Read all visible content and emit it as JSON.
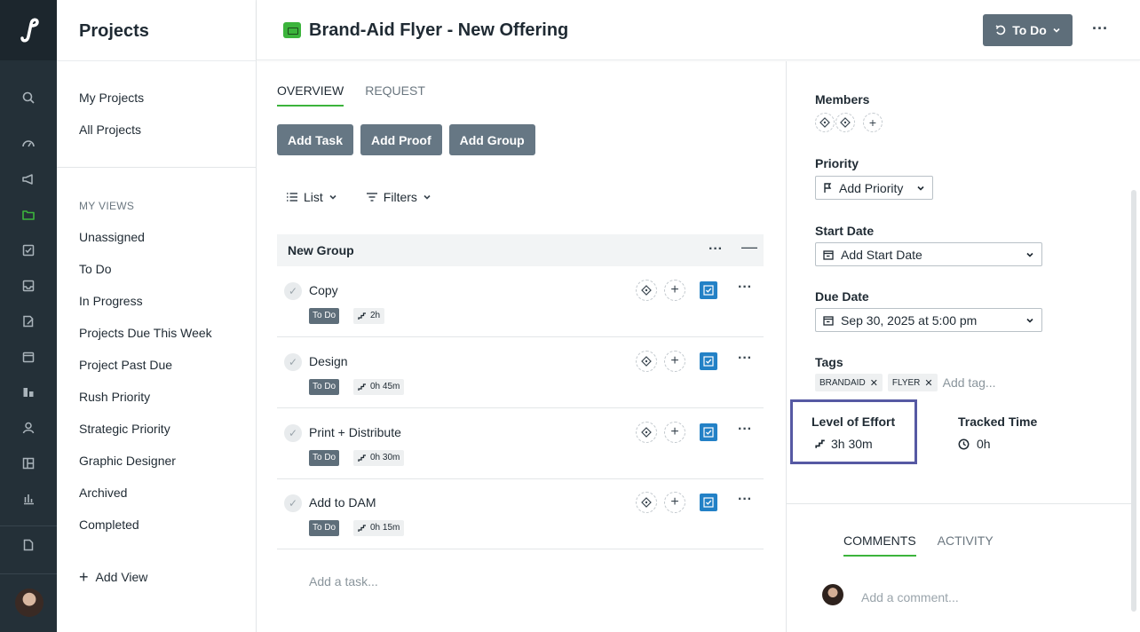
{
  "app": {
    "accent": "#3cb43c",
    "rail_bg": "#243038"
  },
  "rail": {
    "icons": [
      "search-icon",
      "dashboard-icon",
      "megaphone-icon",
      "folder-icon",
      "task-icon",
      "inbox-icon",
      "proof-icon",
      "calendar-icon",
      "board-icon",
      "user-icon",
      "layout-icon",
      "reports-icon",
      "document-icon"
    ]
  },
  "sidebar": {
    "title": "Projects",
    "top_items": [
      "My Projects",
      "All Projects"
    ],
    "section_label": "MY VIEWS",
    "views": [
      "Unassigned",
      "To Do",
      "In Progress",
      "Projects Due This Week",
      "Project Past Due",
      "Rush Priority",
      "Strategic Priority",
      "Graphic Designer",
      "Archived",
      "Completed"
    ],
    "add_view": "Add View"
  },
  "header": {
    "project_title": "Brand-Aid Flyer - New Offering",
    "status": "To Do"
  },
  "main": {
    "tabs": [
      {
        "label": "OVERVIEW",
        "active": true
      },
      {
        "label": "REQUEST",
        "active": false
      }
    ],
    "buttons": [
      "Add Task",
      "Add Proof",
      "Add Group"
    ],
    "view_control": "List",
    "filters_control": "Filters",
    "group_name": "New Group",
    "tasks": [
      {
        "name": "Copy",
        "status": "To Do",
        "effort": "2h"
      },
      {
        "name": "Design",
        "status": "To Do",
        "effort": "0h 45m"
      },
      {
        "name": "Print + Distribute",
        "status": "To Do",
        "effort": "0h 30m"
      },
      {
        "name": "Add to DAM",
        "status": "To Do",
        "effort": "0h 15m"
      }
    ],
    "add_task_placeholder": "Add a task..."
  },
  "details": {
    "members_label": "Members",
    "priority_label": "Priority",
    "priority_value": "Add Priority",
    "start_label": "Start Date",
    "start_value": "Add Start Date",
    "due_label": "Due Date",
    "due_value": "Sep 30, 2025 at 5:00 pm",
    "tags_label": "Tags",
    "tags": [
      "BRANDAID",
      "FLYER"
    ],
    "tag_placeholder": "Add tag...",
    "loe_label": "Level of Effort",
    "loe_value": "3h 30m",
    "tracked_label": "Tracked Time",
    "tracked_value": "0h",
    "comment_tabs": [
      {
        "label": "COMMENTS",
        "active": true
      },
      {
        "label": "ACTIVITY",
        "active": false
      }
    ],
    "comment_placeholder": "Add a comment..."
  }
}
